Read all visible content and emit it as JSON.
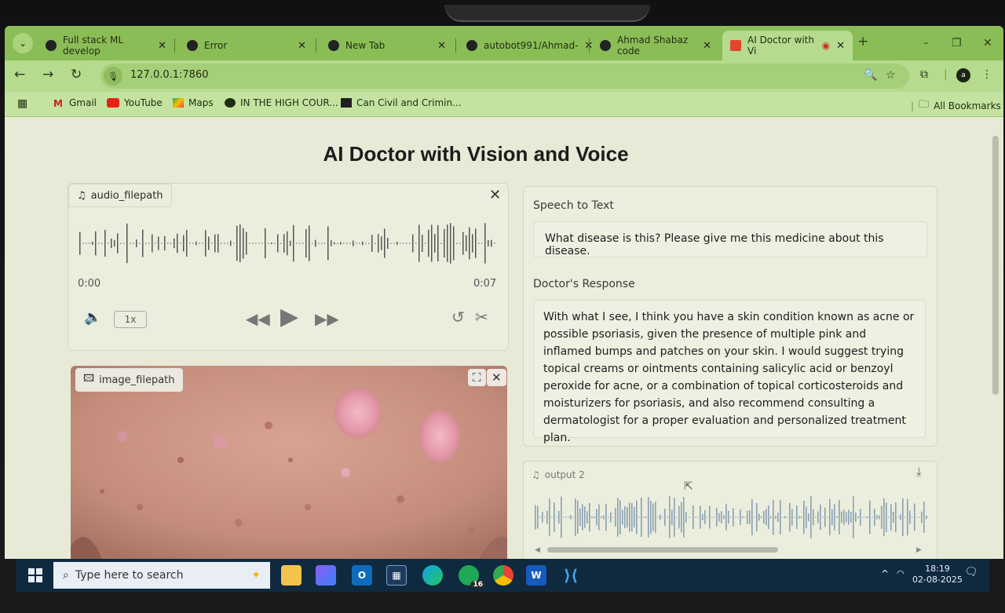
{
  "browser": {
    "tabs": [
      {
        "title": "Full stack ML develop",
        "icon": "globe-icon"
      },
      {
        "title": "Error",
        "icon": "globe-icon"
      },
      {
        "title": "New Tab",
        "icon": "globe-icon"
      },
      {
        "title": "autobot991/Ahmad-",
        "icon": "github-icon"
      },
      {
        "title": "Ahmad Shabaz code",
        "icon": "globe-icon"
      },
      {
        "title": "AI Doctor with Vi",
        "icon": "gradio-icon",
        "active": true
      }
    ],
    "url": "127.0.0.1:7860",
    "avatar_letter": "a",
    "bookmarks": [
      "Gmail",
      "YouTube",
      "Maps",
      "IN THE HIGH COUR...",
      "Can Civil and Crimin..."
    ],
    "all_bookmarks": "All Bookmarks",
    "accent": "#8bbd57"
  },
  "app": {
    "title": "AI Doctor with Vision and Voice",
    "audio_input": {
      "label": "audio_filepath",
      "time_current": "0:00",
      "time_total": "0:07",
      "speed": "1x"
    },
    "image_input": {
      "label": "image_filepath"
    },
    "speech_to_text": {
      "label": "Speech to Text",
      "value": "What disease is this? Please give me this medicine about this disease."
    },
    "doctor_response": {
      "label": "Doctor's Response",
      "value": "With what I see, I think you have a skin condition known as acne or possible psoriasis, given the presence of multiple pink and inflamed bumps and patches on your skin. I would suggest trying topical creams or ointments containing salicylic acid or benzoyl peroxide for acne, or a combination of topical corticosteroids and moisturizers for psoriasis, and also recommend consulting a dermatologist for a proper evaluation and personalized treatment plan."
    },
    "audio_output": {
      "label": "output 2"
    }
  },
  "taskbar": {
    "search_placeholder": "Type here to search",
    "whatsapp_badge": "16",
    "time": "18:19",
    "date": "02-08-2025"
  }
}
